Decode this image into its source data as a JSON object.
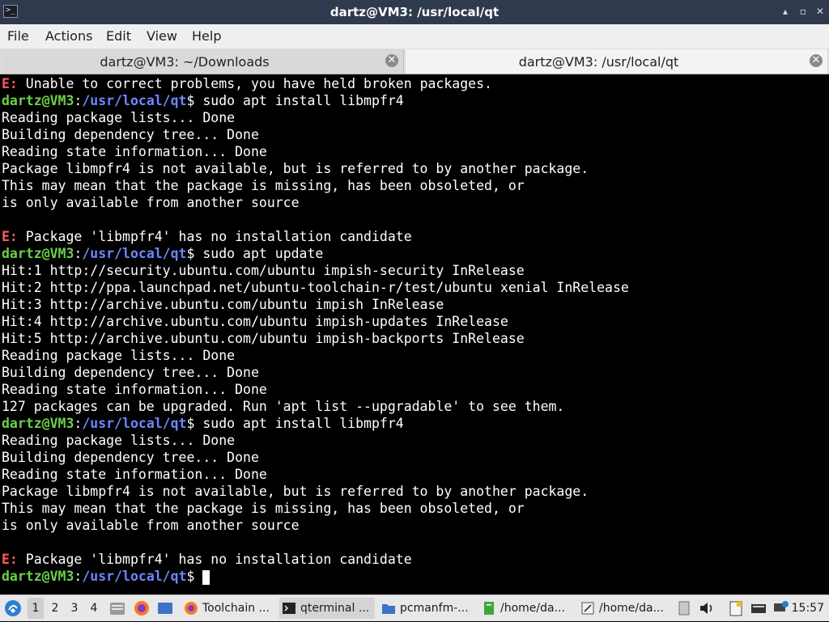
{
  "window": {
    "title": "dartz@VM3: /usr/local/qt",
    "app_icon_glyph": ">_",
    "minimize_glyph": "▴",
    "maximize_glyph": "▫",
    "close_glyph": "✕"
  },
  "menu": {
    "items": [
      "File",
      "Actions",
      "Edit",
      "View",
      "Help"
    ]
  },
  "tabs": [
    {
      "label": "dartz@VM3: ~/Downloads",
      "active": false
    },
    {
      "label": "dartz@VM3: /usr/local/qt",
      "active": true
    }
  ],
  "tab_close_glyph": "✕",
  "terminal": {
    "prompt_user": "dartz@VM3",
    "prompt_sep": ":",
    "prompt_path": "/usr/local/qt",
    "prompt_suffix": "$",
    "error_prefix": "E:",
    "lines": [
      {
        "t": "err",
        "text": " Unable to correct problems, you have held broken packages."
      },
      {
        "t": "cmd",
        "text": " sudo apt install libmpfr4"
      },
      {
        "t": "out",
        "text": "Reading package lists... Done"
      },
      {
        "t": "out",
        "text": "Building dependency tree... Done"
      },
      {
        "t": "out",
        "text": "Reading state information... Done"
      },
      {
        "t": "out",
        "text": "Package libmpfr4 is not available, but is referred to by another package."
      },
      {
        "t": "out",
        "text": "This may mean that the package is missing, has been obsoleted, or"
      },
      {
        "t": "out",
        "text": "is only available from another source"
      },
      {
        "t": "out",
        "text": ""
      },
      {
        "t": "err",
        "text": " Package 'libmpfr4' has no installation candidate"
      },
      {
        "t": "cmd",
        "text": " sudo apt update"
      },
      {
        "t": "out",
        "text": "Hit:1 http://security.ubuntu.com/ubuntu impish-security InRelease"
      },
      {
        "t": "out",
        "text": "Hit:2 http://ppa.launchpad.net/ubuntu-toolchain-r/test/ubuntu xenial InRelease"
      },
      {
        "t": "out",
        "text": "Hit:3 http://archive.ubuntu.com/ubuntu impish InRelease"
      },
      {
        "t": "out",
        "text": "Hit:4 http://archive.ubuntu.com/ubuntu impish-updates InRelease"
      },
      {
        "t": "out",
        "text": "Hit:5 http://archive.ubuntu.com/ubuntu impish-backports InRelease"
      },
      {
        "t": "out",
        "text": "Reading package lists... Done"
      },
      {
        "t": "out",
        "text": "Building dependency tree... Done"
      },
      {
        "t": "out",
        "text": "Reading state information... Done"
      },
      {
        "t": "out",
        "text": "127 packages can be upgraded. Run 'apt list --upgradable' to see them."
      },
      {
        "t": "cmd",
        "text": " sudo apt install libmpfr4"
      },
      {
        "t": "out",
        "text": "Reading package lists... Done"
      },
      {
        "t": "out",
        "text": "Building dependency tree... Done"
      },
      {
        "t": "out",
        "text": "Reading state information... Done"
      },
      {
        "t": "out",
        "text": "Package libmpfr4 is not available, but is referred to by another package."
      },
      {
        "t": "out",
        "text": "This may mean that the package is missing, has been obsoleted, or"
      },
      {
        "t": "out",
        "text": "is only available from another source"
      },
      {
        "t": "out",
        "text": ""
      },
      {
        "t": "err",
        "text": " Package 'libmpfr4' has no installation candidate"
      },
      {
        "t": "cmd",
        "text": " ",
        "cursor": true
      }
    ]
  },
  "taskbar": {
    "start_icon": "lubuntu-start-icon",
    "workspaces": [
      "1",
      "2",
      "3",
      "4"
    ],
    "tasks": [
      {
        "name": "firefox-window",
        "icon": "firefox-icon",
        "label": "Toolchain ..."
      },
      {
        "name": "qterminal-window",
        "icon": "terminal-icon",
        "label": "qterminal ..."
      },
      {
        "name": "pcmanfm-window",
        "icon": "folder-icon",
        "label": "pcmanfm-..."
      },
      {
        "name": "home-window-1",
        "icon": "text-file-icon",
        "label": "/home/da..."
      },
      {
        "name": "home-window-2",
        "icon": "editor-icon",
        "label": "/home/da..."
      }
    ],
    "clock": "15:57"
  },
  "colors": {
    "prompt_user": "#6ccf4a",
    "prompt_path": "#6e86ff",
    "error": "#ff5a5a",
    "titlebar": "#2f3a4e"
  }
}
